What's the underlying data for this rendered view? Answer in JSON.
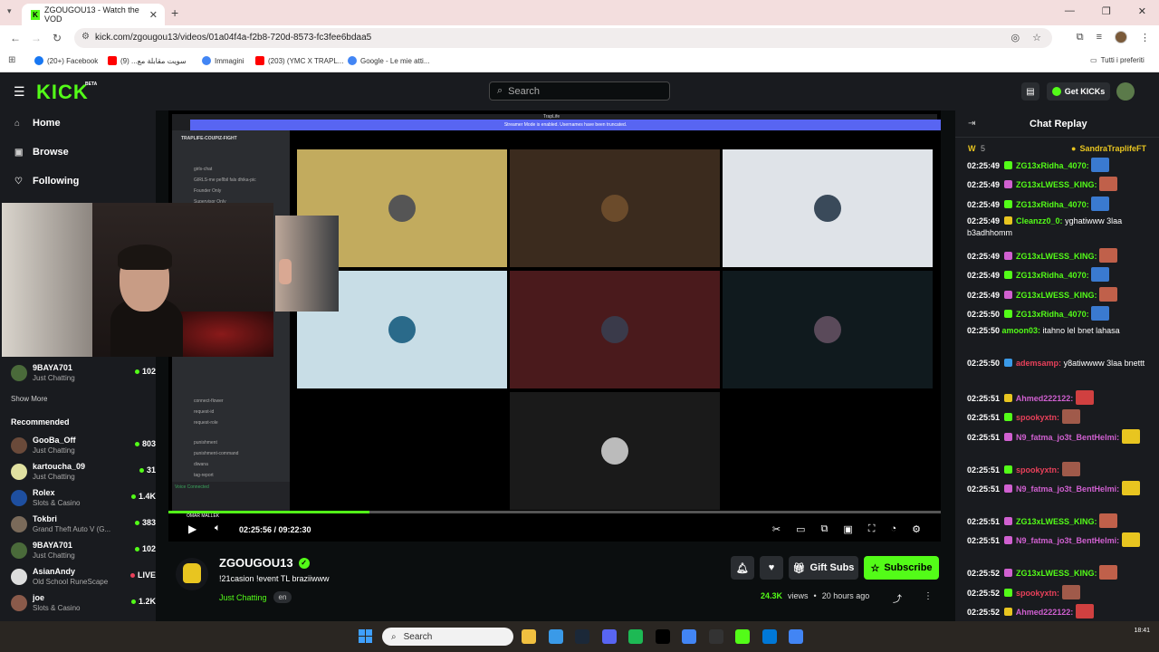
{
  "browser": {
    "tab_title": "ZGOUGOU13 - Watch the VOD",
    "url": "kick.com/zgougou13/videos/01a04f4a-f2b8-720d-8573-fc3fee6bdaa5",
    "bookmarks": [
      {
        "label": "(20+) Facebook",
        "color": "#1877f2"
      },
      {
        "label": "سويت مقابلة مع... (9)",
        "color": "#ff0000"
      },
      {
        "label": "Immagini",
        "color": "#4285f4"
      },
      {
        "label": "(203) (YMC X TRAPL...",
        "color": "#ff0000"
      },
      {
        "label": "Google - Le mie atti...",
        "color": "#4285f4"
      }
    ],
    "bookmarks_right": "Tutti i preferiti"
  },
  "header": {
    "logo": "KICK",
    "beta": "BETA",
    "search_placeholder": "Search",
    "get_kicks": "Get KICKs"
  },
  "sidebar": {
    "nav": [
      {
        "label": "Home",
        "icon": "home-icon"
      },
      {
        "label": "Browse",
        "icon": "browse-icon"
      },
      {
        "label": "Following",
        "icon": "heart-icon"
      }
    ],
    "following": [
      {
        "name": "9BAYA701",
        "category": "Just Chatting",
        "viewers": "102",
        "color": "#4a6a3a"
      }
    ],
    "show_more": "Show More",
    "recommended_label": "Recommended",
    "recommended": [
      {
        "name": "GooBa_Off",
        "category": "Just Chatting",
        "viewers": "803",
        "color": "#6a4a3a"
      },
      {
        "name": "kartoucha_09",
        "category": "Just Chatting",
        "viewers": "31",
        "color": "#e0e0a0"
      },
      {
        "name": "Rolex",
        "category": "Slots & Casino",
        "viewers": "1.4K",
        "color": "#1e4fa0"
      },
      {
        "name": "Tokbri",
        "category": "Grand Theft Auto V (G...",
        "viewers": "383",
        "color": "#7a6a5a"
      },
      {
        "name": "9BAYA701",
        "category": "Just Chatting",
        "viewers": "102",
        "color": "#4a6a3a"
      },
      {
        "name": "AsianAndy",
        "category": "Old School RuneScape",
        "viewers": "LIVE",
        "color": "#ddd"
      },
      {
        "name": "joe",
        "category": "Slots & Casino",
        "viewers": "1.2K",
        "color": "#8a5a4a"
      }
    ]
  },
  "player": {
    "discord_banner": "Streamer Mode is enabled. Usernames have been truncated.",
    "discord_server": "TRAPLIFE-COUPIZ-FIGHT",
    "discord_title": "TrapLife",
    "discord_channels": [
      "girls-chat",
      "GIRLS-me pelĩbil fals dhika-pic",
      "Founder Only",
      "Supervisor Only",
      "connect-flower",
      "request-id",
      "request-role",
      "punishment",
      "punishment-command",
      "diwana",
      "tag-report"
    ],
    "voice_connected": "Voice Connected",
    "streamer_tag": "OMAR MALLEK",
    "time": "02:25:56 / 09:22:30",
    "progress": 0.26,
    "tiles": [
      {
        "bg": "#c2ab5e",
        "pic": "#555"
      },
      {
        "bg": "#3b2b1e",
        "pic": "#6b4b2b"
      },
      {
        "bg": "#dfe3e8",
        "pic": "#3a4a5a"
      },
      {
        "bg": "#c8dde6",
        "pic": "#2a6a8a"
      },
      {
        "bg": "#4a1a1c",
        "pic": "#3a3a4a"
      },
      {
        "bg": "#101a1e",
        "pic": "#5a4a5a"
      },
      {
        "bg": "#000000",
        "pic": "#000"
      },
      {
        "bg": "#1a1a1a",
        "pic": "#bbb"
      },
      {
        "bg": "#000000",
        "pic": "#000"
      }
    ]
  },
  "stream": {
    "name": "ZGOUGOU13",
    "title": "!21casion !event TL braziiwww",
    "category": "Just Chatting",
    "language": "en",
    "gift_subs": "Gift Subs",
    "subscribe": "Subscribe",
    "views": "24.3K",
    "views_label": "views",
    "ago": "20 hours ago"
  },
  "chat": {
    "title": "Chat Replay",
    "pinned_w": "W",
    "pinned_n": "5",
    "pinned_user": "SandraTraplifeFT",
    "messages": [
      {
        "ts": "02:25:49",
        "badge": "#53fc18",
        "user": "ZG13xRidha_4070:",
        "ucolor": "#53fc18",
        "text": "",
        "emote": "#3a7ad0"
      },
      {
        "ts": "02:25:49",
        "badge": "#d060d0",
        "user": "ZG13xLWESS_KING:",
        "ucolor": "#53fc18",
        "text": "",
        "emote": "#c0604a"
      },
      {
        "ts": "02:25:49",
        "badge": "#53fc18",
        "user": "ZG13xRidha_4070:",
        "ucolor": "#53fc18",
        "text": "",
        "emote": "#3a7ad0"
      },
      {
        "ts": "02:25:49",
        "badge": "#e8c520",
        "user": "Cleanzz0_0:",
        "ucolor": "#53fc18",
        "text": "yghatiwww 3laa b3adhhomm",
        "emote": ""
      },
      {
        "ts": "02:25:49",
        "badge": "#d060d0",
        "user": "ZG13xLWESS_KING:",
        "ucolor": "#53fc18",
        "text": "",
        "emote": "#c0604a"
      },
      {
        "ts": "02:25:49",
        "badge": "#53fc18",
        "user": "ZG13xRidha_4070:",
        "ucolor": "#53fc18",
        "text": "",
        "emote": "#3a7ad0"
      },
      {
        "ts": "02:25:49",
        "badge": "#d060d0",
        "user": "ZG13xLWESS_KING:",
        "ucolor": "#53fc18",
        "text": "",
        "emote": "#c0604a"
      },
      {
        "ts": "02:25:50",
        "badge": "#53fc18",
        "user": "ZG13xRidha_4070:",
        "ucolor": "#53fc18",
        "text": "",
        "emote": "#3a7ad0"
      },
      {
        "ts": "02:25:50",
        "badge": "",
        "user": "amoon03:",
        "ucolor": "#53fc18",
        "text": "itahno lel bnet lahasa",
        "emote": ""
      },
      {
        "ts": "02:25:50",
        "badge": "#3a9ae8",
        "user": "ademsamp:",
        "ucolor": "#e8405a",
        "text": "y8atiwwww 3laa bnettt",
        "emote": ""
      },
      {
        "ts": "02:25:51",
        "badge": "#e8c520",
        "user": "Ahmed222122:",
        "ucolor": "#d060d0",
        "text": "",
        "emote": "#d04040"
      },
      {
        "ts": "02:25:51",
        "badge": "#53fc18",
        "user": "spookyxtn:",
        "ucolor": "#e8405a",
        "text": "",
        "emote": "#a05a4a"
      },
      {
        "ts": "02:25:51",
        "badge": "#d060d0",
        "user": "N9_fatma_jo3t_BentHelmi:",
        "ucolor": "#d060d0",
        "text": "",
        "emote": "#e8c520"
      },
      {
        "ts": "02:25:51",
        "badge": "#53fc18",
        "user": "spookyxtn:",
        "ucolor": "#e8405a",
        "text": "",
        "emote": "#a05a4a"
      },
      {
        "ts": "02:25:51",
        "badge": "#d060d0",
        "user": "N9_fatma_jo3t_BentHelmi:",
        "ucolor": "#d060d0",
        "text": "",
        "emote": "#e8c520"
      },
      {
        "ts": "02:25:51",
        "badge": "#d060d0",
        "user": "ZG13xLWESS_KING:",
        "ucolor": "#53fc18",
        "text": "",
        "emote": "#c0604a"
      },
      {
        "ts": "02:25:51",
        "badge": "#d060d0",
        "user": "N9_fatma_jo3t_BentHelmi:",
        "ucolor": "#d060d0",
        "text": "",
        "emote": "#e8c520"
      },
      {
        "ts": "02:25:52",
        "badge": "#d060d0",
        "user": "ZG13xLWESS_KING:",
        "ucolor": "#53fc18",
        "text": "",
        "emote": "#c0604a"
      },
      {
        "ts": "02:25:52",
        "badge": "#53fc18",
        "user": "spookyxtn:",
        "ucolor": "#e8405a",
        "text": "",
        "emote": "#a05a4a"
      },
      {
        "ts": "02:25:52",
        "badge": "#e8c520",
        "user": "Ahmed222122:",
        "ucolor": "#d060d0",
        "text": "",
        "emote": "#d04040"
      }
    ]
  },
  "taskbar": {
    "search": "Search",
    "time": "18:41",
    "icons": [
      "#f0c040",
      "#3a9ae8",
      "#1b2838",
      "#5865f2",
      "#1db954",
      "#000",
      "#4285f4",
      "#333",
      "#53fc18",
      "#0078d7",
      "#4285f4"
    ]
  }
}
